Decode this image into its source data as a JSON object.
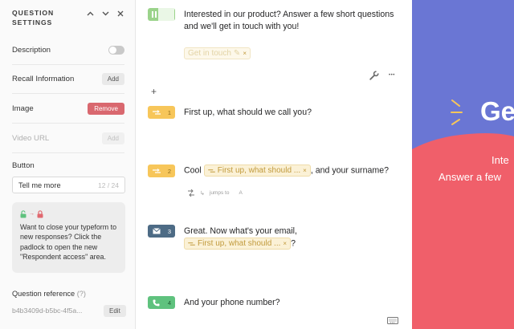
{
  "settings": {
    "title": "QUESTION SETTINGS",
    "description_label": "Description",
    "recall_label": "Recall Information",
    "recall_button": "Add",
    "image_label": "Image",
    "image_button": "Remove",
    "video_label": "Video URL",
    "video_button": "Add",
    "button_label": "Button",
    "button_value": "Tell me more",
    "button_counter": "12 / 24",
    "info_text": "Want to close your typeform to new responses? Click the padlock to open the new \"Respondent access\" area.",
    "qref_label": "Question reference",
    "qref_hint": "(?)",
    "qref_value": "b4b3409d-b5bc-4f5a...",
    "qref_button": "Edit"
  },
  "questions": {
    "welcome": {
      "text": "Interested in our product? Answer a few short questions and we'll get in touch with you!",
      "pill_text": "Get in touch"
    },
    "q1": {
      "number": "1",
      "text": "First up, what should we call you?"
    },
    "q2": {
      "number": "2",
      "pre": "Cool",
      "pill": "First up, what should ...",
      "post": ", and your surname?",
      "jump_text": "jumps to",
      "jump_target": "A"
    },
    "q3": {
      "number": "3",
      "text": "Great. Now what's your email,",
      "pill": "First up, what should ...",
      "post": "?"
    },
    "q4": {
      "number": "4",
      "text": "And your phone number?"
    }
  },
  "builder": {
    "add_symbol": "+",
    "more_symbol": "•••"
  },
  "preview": {
    "headline": "Ge",
    "line1": "Inte",
    "line2": "Answer a few"
  },
  "colors": {
    "preview_bg": "#6a76d4",
    "preview_accent": "#f05f6a",
    "short_text_badge": "#f7c65a",
    "email_badge": "#4d6b85",
    "phone_badge": "#5fc27e",
    "remove_button": "#d9686f"
  },
  "icons": [
    "chevron-up-icon",
    "chevron-down-icon",
    "close-icon",
    "unlock-icon",
    "lock-icon",
    "short-text-icon",
    "email-icon",
    "phone-icon",
    "wrench-icon",
    "more-icon",
    "logic-icon",
    "keyboard-icon",
    "welcome-screen-icon"
  ]
}
